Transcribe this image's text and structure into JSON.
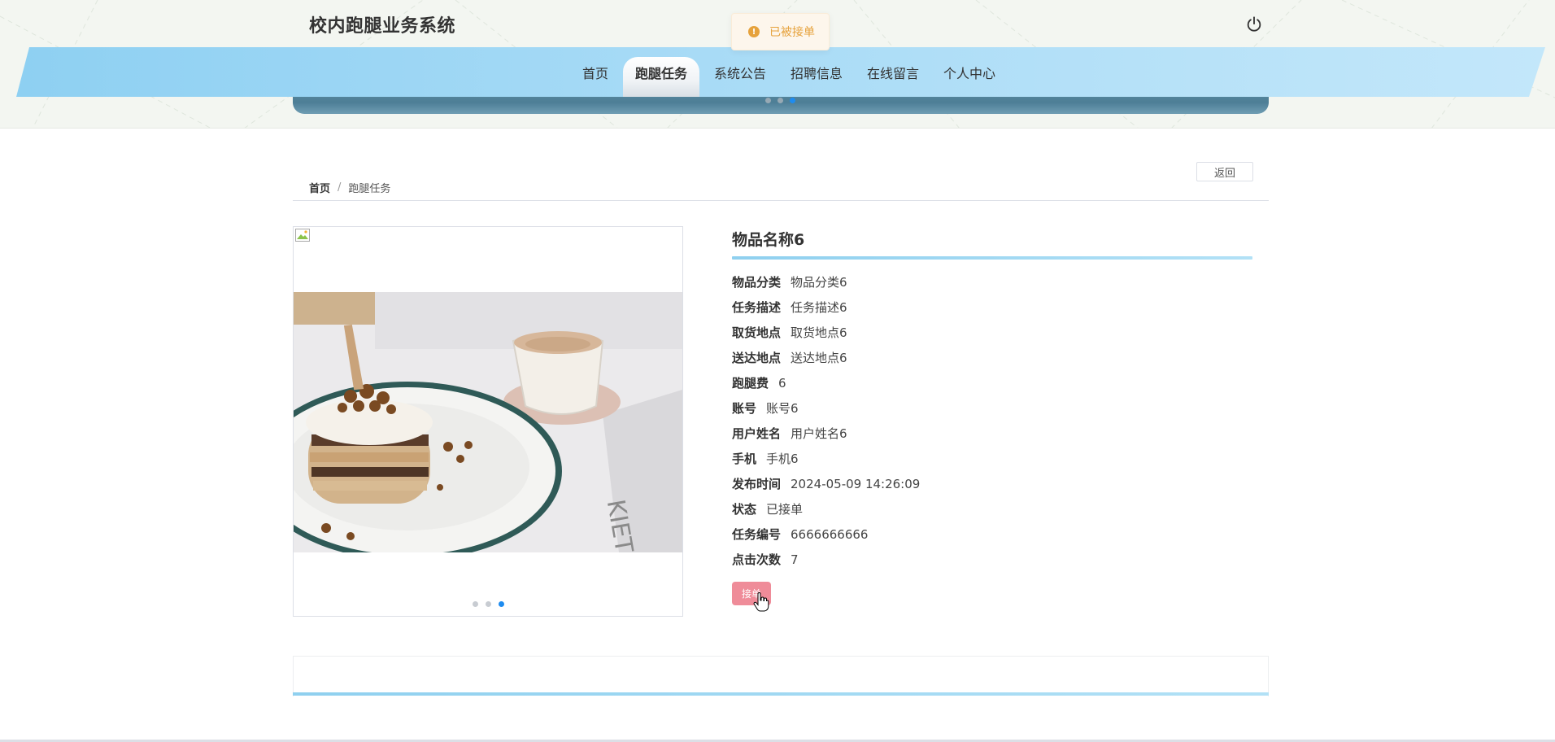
{
  "app": {
    "title": "校内跑腿业务系统",
    "accent": "#8ed0f2",
    "power_icon": "power-icon"
  },
  "toast": {
    "message": "已被接单",
    "icon": "warning-circle-icon",
    "color": "#e6a23c"
  },
  "nav": {
    "items": [
      {
        "label": "首页",
        "active": false
      },
      {
        "label": "跑腿任务",
        "active": true
      },
      {
        "label": "系统公告",
        "active": false
      },
      {
        "label": "招聘信息",
        "active": false
      },
      {
        "label": "在线留言",
        "active": false
      },
      {
        "label": "个人中心",
        "active": false
      }
    ]
  },
  "banner": {
    "slide_count": 3,
    "active_index": 2
  },
  "breadcrumb": {
    "home": "首页",
    "separator": "/",
    "current": "跑腿任务"
  },
  "back_button": "返回",
  "gallery": {
    "slide_count": 3,
    "active_index": 2
  },
  "detail": {
    "title": "物品名称6",
    "fields": [
      {
        "label": "物品分类",
        "value": "物品分类6"
      },
      {
        "label": "任务描述",
        "value": "任务描述6"
      },
      {
        "label": "取货地点",
        "value": "取货地点6"
      },
      {
        "label": "送达地点",
        "value": "送达地点6"
      },
      {
        "label": "跑腿费",
        "value": "6"
      },
      {
        "label": "账号",
        "value": "账号6"
      },
      {
        "label": "用户姓名",
        "value": "用户姓名6"
      },
      {
        "label": "手机",
        "value": "手机6"
      },
      {
        "label": "发布时间",
        "value": "2024-05-09 14:26:09"
      },
      {
        "label": "状态",
        "value": "已接单"
      },
      {
        "label": "任务编号",
        "value": "6666666666"
      },
      {
        "label": "点击次数",
        "value": "7"
      }
    ],
    "accept_button": "接单",
    "accept_color": "#ef8c99"
  }
}
